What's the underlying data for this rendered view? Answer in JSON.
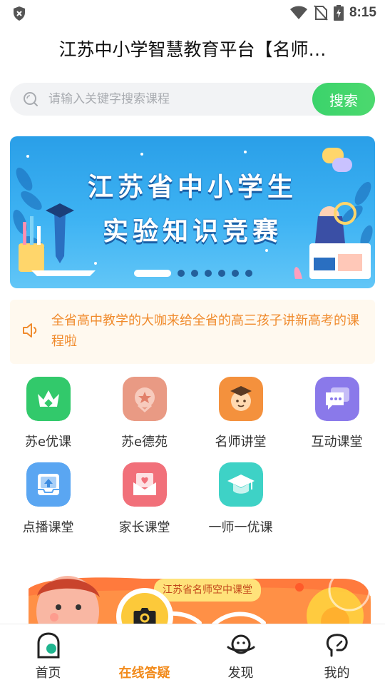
{
  "status_bar": {
    "time": "8:15",
    "left_icon": "shield-x-icon",
    "right_icons": [
      "wifi-icon",
      "no-sim-icon",
      "battery-charging-icon"
    ]
  },
  "header": {
    "title": "江苏中小学智慧教育平台【名师…"
  },
  "search": {
    "placeholder": "请输入关键字搜索课程",
    "value": "",
    "button_label": "搜索",
    "icon": "search-icon"
  },
  "banner": {
    "line1": "江苏省中小学生",
    "line2": "实验知识竞赛",
    "slide_count": 7,
    "active_index": 0,
    "colors": {
      "sky": "#2a9fe8",
      "title_shadow": "#1b5fa6"
    }
  },
  "notice": {
    "icon": "speaker-icon",
    "text": "全省高中教学的大咖来给全省的高三孩子讲新高考的课程啦",
    "color": "#f08b2d"
  },
  "features": [
    {
      "label": "苏e优课",
      "icon": "crown-icon",
      "color": "#32c96b"
    },
    {
      "label": "苏e德苑",
      "icon": "medal-icon",
      "color": "#e99a84"
    },
    {
      "label": "名师讲堂",
      "icon": "teacher-icon",
      "color": "#f4913d"
    },
    {
      "label": "互动课堂",
      "icon": "chat-icon",
      "color": "#8a79ea"
    },
    {
      "label": "点播课堂",
      "icon": "upload-tray-icon",
      "color": "#5aa6f2"
    },
    {
      "label": "家长课堂",
      "icon": "heart-mail-icon",
      "color": "#f1707a"
    },
    {
      "label": "一师一优课",
      "icon": "graduation-cap-icon",
      "color": "#3ed2c6"
    }
  ],
  "promo": {
    "tag": "江苏省名师空中课堂"
  },
  "tabbar": {
    "tabs": [
      {
        "label": "首页",
        "icon": "home-icon",
        "active": false
      },
      {
        "label": "在线答疑",
        "icon": "camera-icon",
        "active": true
      },
      {
        "label": "发现",
        "icon": "planet-icon",
        "active": false
      },
      {
        "label": "我的",
        "icon": "profile-icon",
        "active": false
      }
    ],
    "active_color": "#f28a1a"
  }
}
